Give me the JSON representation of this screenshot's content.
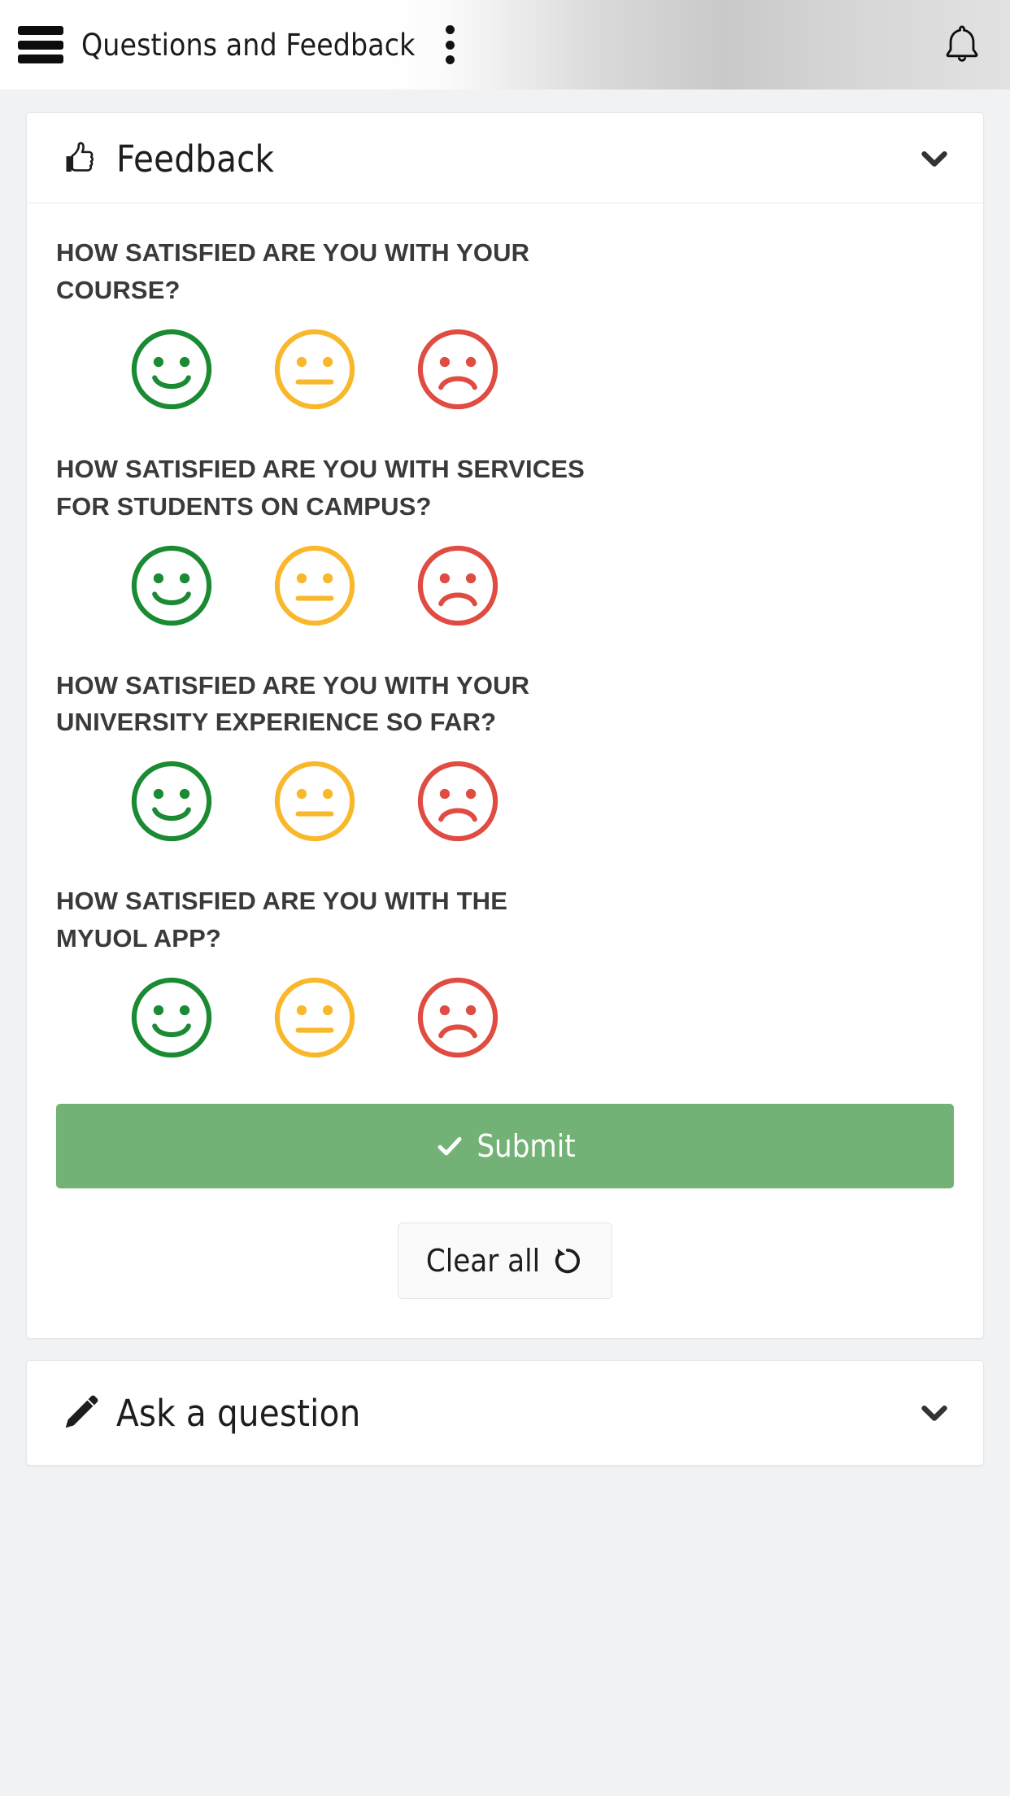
{
  "header": {
    "title": "Questions and Feedback",
    "menu_icon": "hamburger-menu-icon",
    "overflow_icon": "kebab-menu-icon",
    "notifications_icon": "bell-icon"
  },
  "colors": {
    "happy": "#1a8a33",
    "neutral": "#f9b82b",
    "sad": "#e04b42",
    "submit_green": "#72b276",
    "page_background": "#f0f2f4",
    "text_dark": "#3a3a3a"
  },
  "feedback_card": {
    "title": "Feedback",
    "icon": "thumbs-up-icon",
    "collapse_icon": "chevron-down-icon",
    "questions": [
      {
        "label": "HOW SATISFIED ARE YOU WITH YOUR COURSE?",
        "options": [
          "happy",
          "neutral",
          "sad"
        ],
        "selected": null
      },
      {
        "label": "HOW SATISFIED ARE YOU WITH SERVICES FOR STUDENTS ON CAMPUS?",
        "options": [
          "happy",
          "neutral",
          "sad"
        ],
        "selected": null
      },
      {
        "label": "HOW SATISFIED ARE YOU WITH YOUR UNIVERSITY EXPERIENCE SO FAR?",
        "options": [
          "happy",
          "neutral",
          "sad"
        ],
        "selected": null
      },
      {
        "label": "HOW SATISFIED ARE YOU WITH THE MYUOL APP?",
        "options": [
          "happy",
          "neutral",
          "sad"
        ],
        "selected": null
      }
    ],
    "submit_label": "Submit",
    "submit_icon": "check-icon",
    "clear_label": "Clear all",
    "clear_icon": "undo-rotate-icon"
  },
  "ask_card": {
    "title": "Ask a question",
    "icon": "pencil-icon",
    "collapse_icon": "chevron-down-icon"
  }
}
